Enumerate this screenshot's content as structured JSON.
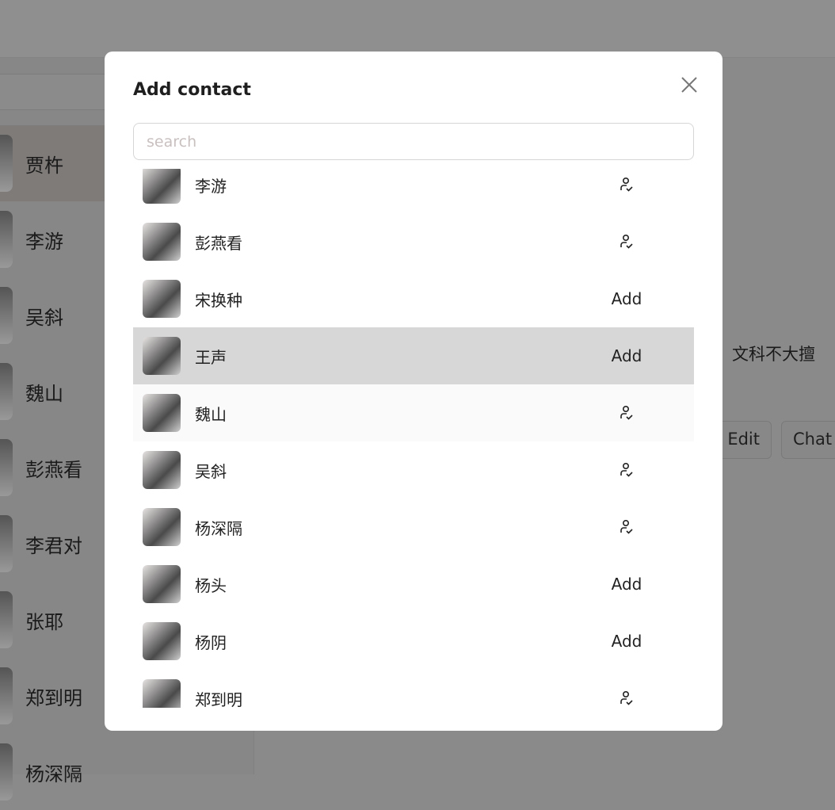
{
  "sidebar": {
    "items": [
      {
        "name": "贾杵",
        "selected": true
      },
      {
        "name": "李游"
      },
      {
        "name": "吴斜"
      },
      {
        "name": "魏山"
      },
      {
        "name": "彭燕看"
      },
      {
        "name": "李君对"
      },
      {
        "name": "张耶"
      },
      {
        "name": "郑到明"
      },
      {
        "name": "杨深隔"
      }
    ]
  },
  "profile": {
    "signature": "文科不大擅",
    "edit_label": "Edit",
    "chat_label": "Chat"
  },
  "modal": {
    "title": "Add contact",
    "search_placeholder": "search",
    "search_value": "",
    "add_label": "Add",
    "contacts": [
      {
        "name": "李游",
        "status": "added",
        "icon": "user-check-icon"
      },
      {
        "name": "彭燕看",
        "status": "added",
        "icon": "user-check-icon"
      },
      {
        "name": "宋换种",
        "status": "add"
      },
      {
        "name": "王声",
        "status": "add"
      },
      {
        "name": "魏山",
        "status": "added",
        "icon": "user-check-icon"
      },
      {
        "name": "吴斜",
        "status": "added",
        "icon": "user-check-icon"
      },
      {
        "name": "杨深隔",
        "status": "added",
        "icon": "user-check-icon"
      },
      {
        "name": "杨头",
        "status": "add"
      },
      {
        "name": "杨阴",
        "status": "add"
      },
      {
        "name": "郑到明",
        "status": "added",
        "icon": "user-check-icon"
      }
    ]
  }
}
